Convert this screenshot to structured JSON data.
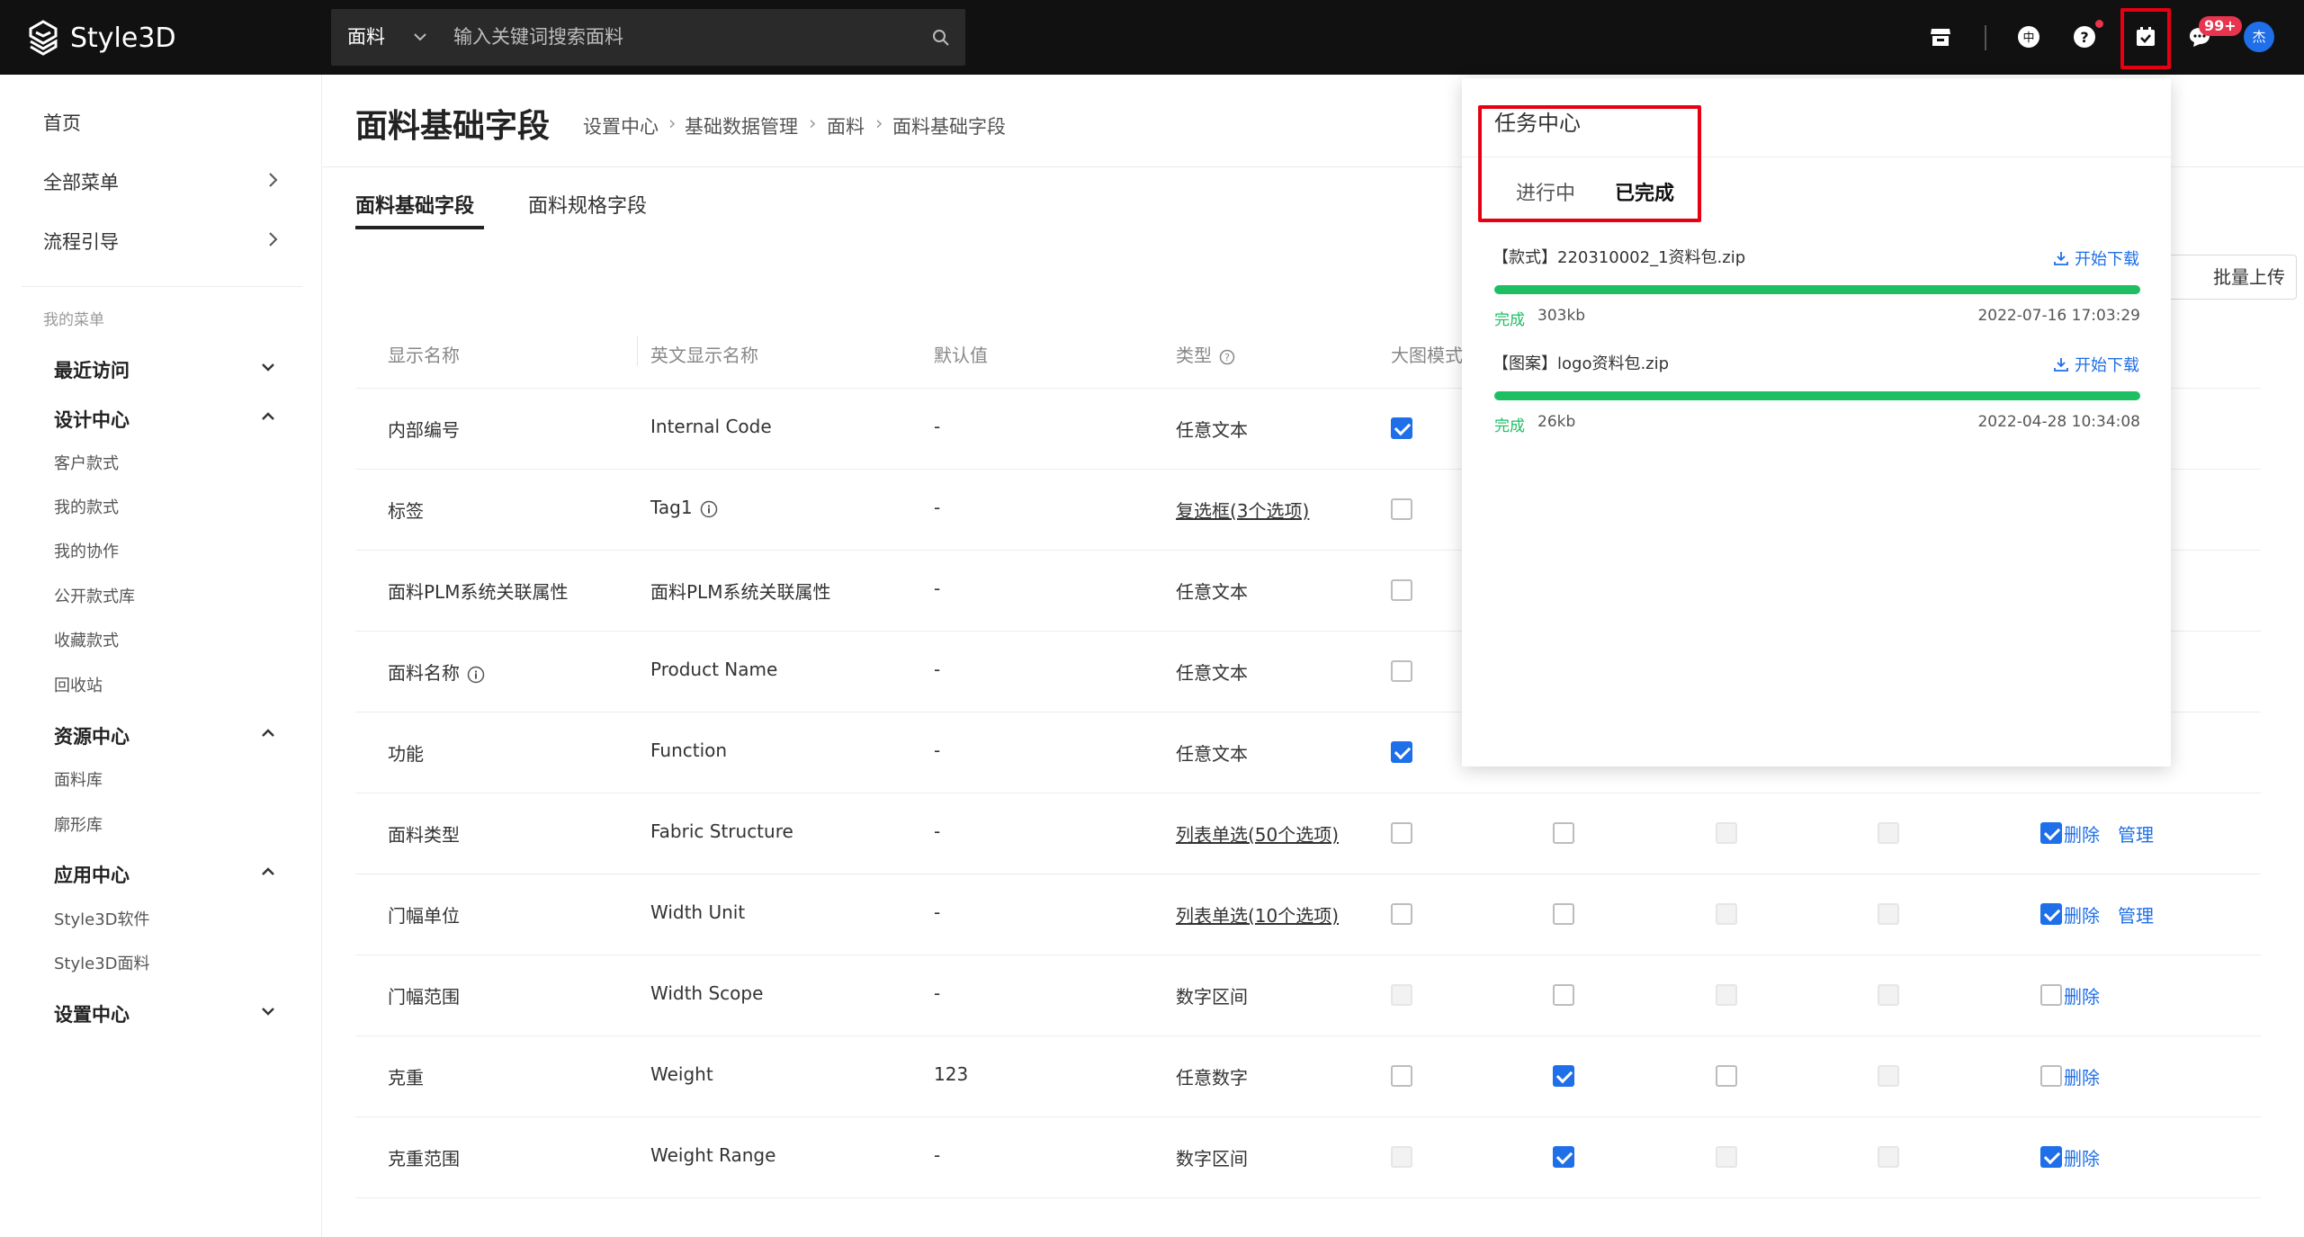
{
  "app": {
    "name": "Style3D"
  },
  "search": {
    "category": "面料",
    "placeholder": "输入关键词搜索面料"
  },
  "topbar": {
    "message_badge": "99+",
    "avatar_text": "杰",
    "lang_icon_text": "中"
  },
  "sidebar": {
    "top_items": [
      {
        "label": "首页"
      },
      {
        "label": "全部菜单"
      },
      {
        "label": "流程引导"
      }
    ],
    "caption": "我的菜单",
    "groups": [
      {
        "label": "最近访问",
        "expanded": false,
        "items": []
      },
      {
        "label": "设计中心",
        "expanded": true,
        "items": [
          "客户款式",
          "我的款式",
          "我的协作",
          "公开款式库",
          "收藏款式",
          "回收站"
        ]
      },
      {
        "label": "资源中心",
        "expanded": true,
        "items": [
          "面料库",
          "廓形库"
        ]
      },
      {
        "label": "应用中心",
        "expanded": true,
        "items": [
          "Style3D软件",
          "Style3D面料"
        ]
      },
      {
        "label": "设置中心",
        "expanded": false,
        "items": []
      }
    ]
  },
  "page": {
    "title": "面料基础字段",
    "breadcrumb": [
      "设置中心",
      "基础数据管理",
      "面料",
      "面料基础字段"
    ],
    "tabs": [
      "面料基础字段",
      "面料规格字段"
    ],
    "batch_upload": "批量上传"
  },
  "table": {
    "headers": [
      "显示名称",
      "英文显示名称",
      "默认值",
      "类型",
      "大图模式"
    ],
    "actions": {
      "delete": "删除",
      "manage": "管理"
    },
    "rows": [
      {
        "name": "内部编号",
        "en": "Internal Code",
        "default": "-",
        "type": "任意文本",
        "type_link": false,
        "name_info": false,
        "en_info": false,
        "c1": "on",
        "c2": null,
        "c3": null,
        "c4": null,
        "c5": null,
        "del": false,
        "manage": false
      },
      {
        "name": "标签",
        "en": "Tag1",
        "default": "-",
        "type": "复选框(3个选项)",
        "type_link": true,
        "name_info": false,
        "en_info": true,
        "c1": "off",
        "c2": null,
        "c3": null,
        "c4": null,
        "c5": null,
        "del": false,
        "manage": false
      },
      {
        "name": "面料PLM系统关联属性",
        "en": "面料PLM系统关联属性",
        "default": "-",
        "type": "任意文本",
        "type_link": false,
        "name_info": false,
        "en_info": false,
        "c1": "off",
        "c2": null,
        "c3": null,
        "c4": null,
        "c5": null,
        "del": false,
        "manage": false
      },
      {
        "name": "面料名称",
        "en": "Product Name",
        "default": "-",
        "type": "任意文本",
        "type_link": false,
        "name_info": true,
        "en_info": false,
        "c1": "off",
        "c2": null,
        "c3": null,
        "c4": null,
        "c5": null,
        "del": false,
        "manage": false
      },
      {
        "name": "功能",
        "en": "Function",
        "default": "-",
        "type": "任意文本",
        "type_link": false,
        "name_info": false,
        "en_info": false,
        "c1": "on",
        "c2": null,
        "c3": null,
        "c4": null,
        "c5": null,
        "del": false,
        "manage": false
      },
      {
        "name": "面料类型",
        "en": "Fabric Structure",
        "default": "-",
        "type": "列表单选(50个选项)",
        "type_link": true,
        "name_info": false,
        "en_info": false,
        "c1": "off",
        "c2": "off",
        "c3": "dis",
        "c4": "dis",
        "c5": "on",
        "del": true,
        "manage": true
      },
      {
        "name": "门幅单位",
        "en": "Width Unit",
        "default": "-",
        "type": "列表单选(10个选项)",
        "type_link": true,
        "name_info": false,
        "en_info": false,
        "c1": "off",
        "c2": "off",
        "c3": "dis",
        "c4": "dis",
        "c5": "on",
        "del": true,
        "manage": true
      },
      {
        "name": "门幅范围",
        "en": "Width Scope",
        "default": "-",
        "type": "数字区间",
        "type_link": false,
        "name_info": false,
        "en_info": false,
        "c1": "dis",
        "c2": "off",
        "c3": "dis",
        "c4": "dis",
        "c5": "off",
        "del": true,
        "manage": false
      },
      {
        "name": "克重",
        "en": "Weight",
        "default": "123",
        "type": "任意数字",
        "type_link": false,
        "name_info": false,
        "en_info": false,
        "c1": "off",
        "c2": "on",
        "c3": "off",
        "c4": "dis",
        "c5": "off",
        "del": true,
        "manage": false
      },
      {
        "name": "克重范围",
        "en": "Weight Range",
        "default": "-",
        "type": "数字区间",
        "type_link": false,
        "name_info": false,
        "en_info": false,
        "c1": "dis",
        "c2": "on",
        "c3": "dis",
        "c4": "dis",
        "c5": "on",
        "del": true,
        "manage": false
      }
    ]
  },
  "task_panel": {
    "title": "任务中心",
    "tabs": [
      "进行中",
      "已完成"
    ],
    "active_tab": 1,
    "download_label": "开始下载",
    "tasks": [
      {
        "name": "【款式】220310002_1资料包.zip",
        "status": "完成",
        "size": "303kb",
        "time": "2022-07-16 17:03:29",
        "progress": 100
      },
      {
        "name": "【图案】logo资料包.zip",
        "status": "完成",
        "size": "26kb",
        "time": "2022-04-28 10:34:08",
        "progress": 100
      }
    ]
  },
  "colors": {
    "accent": "#1e6fe8",
    "success": "#1ebe63",
    "highlight": "#e60012",
    "topbar": "#111111",
    "badge": "#e8344e"
  }
}
